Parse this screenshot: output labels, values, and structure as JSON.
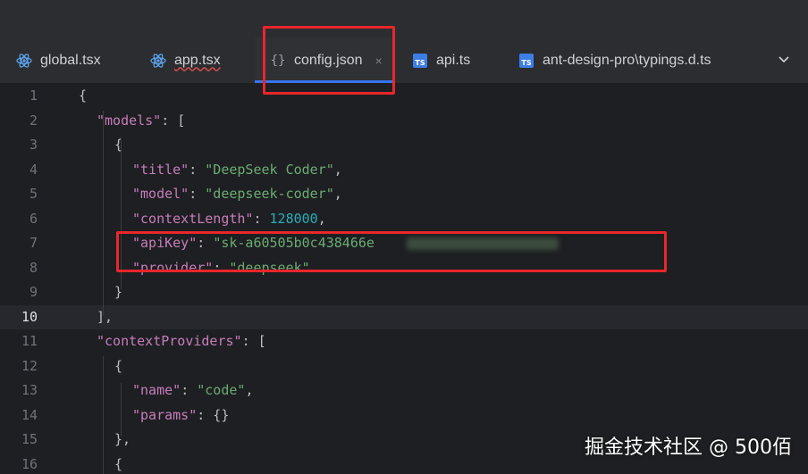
{
  "tabs": [
    {
      "label": "global.tsx",
      "icon": "react-icon",
      "active": false
    },
    {
      "label": "app.tsx",
      "icon": "react-icon",
      "active": false
    },
    {
      "label": "config.json",
      "icon": "json-braces-icon",
      "active": true,
      "close": "×"
    },
    {
      "label": "api.ts",
      "icon": "typescript-icon",
      "active": false,
      "badge": "TS"
    },
    {
      "label": "ant-design-pro\\typings.d.ts",
      "icon": "typescript-icon",
      "active": false,
      "badge": "TS"
    }
  ],
  "editor": {
    "current_line": 10,
    "lines": [
      {
        "num": "1",
        "tokens": [
          [
            "p",
            "{"
          ]
        ]
      },
      {
        "num": "2",
        "tokens": [
          [
            "k",
            "\"models\""
          ],
          [
            "p",
            ": ["
          ]
        ]
      },
      {
        "num": "3",
        "tokens": [
          [
            "p",
            "{"
          ]
        ]
      },
      {
        "num": "4",
        "tokens": [
          [
            "k",
            "\"title\""
          ],
          [
            "p",
            ": "
          ],
          [
            "s",
            "\"DeepSeek Coder\""
          ],
          [
            "p",
            ","
          ]
        ]
      },
      {
        "num": "5",
        "tokens": [
          [
            "k",
            "\"model\""
          ],
          [
            "p",
            ": "
          ],
          [
            "s",
            "\"deepseek-coder\""
          ],
          [
            "p",
            ","
          ]
        ]
      },
      {
        "num": "6",
        "tokens": [
          [
            "k",
            "\"contextLength\""
          ],
          [
            "p",
            ": "
          ],
          [
            "n",
            "128000"
          ],
          [
            "p",
            ","
          ]
        ]
      },
      {
        "num": "7",
        "tokens": [
          [
            "k",
            "\"apiKey\""
          ],
          [
            "p",
            ": "
          ],
          [
            "s",
            "\"sk-a60505b0c438466e"
          ]
        ]
      },
      {
        "num": "8",
        "tokens": [
          [
            "k",
            "\"provider\""
          ],
          [
            "p",
            ": "
          ],
          [
            "s",
            "\"deepseek\""
          ]
        ]
      },
      {
        "num": "9",
        "tokens": [
          [
            "p",
            "}"
          ]
        ]
      },
      {
        "num": "10",
        "tokens": [
          [
            "p",
            "],"
          ]
        ]
      },
      {
        "num": "11",
        "tokens": [
          [
            "k",
            "\"contextProviders\""
          ],
          [
            "p",
            ": ["
          ]
        ]
      },
      {
        "num": "12",
        "tokens": [
          [
            "p",
            "{"
          ]
        ]
      },
      {
        "num": "13",
        "tokens": [
          [
            "k",
            "\"name\""
          ],
          [
            "p",
            ": "
          ],
          [
            "s",
            "\"code\""
          ],
          [
            "p",
            ","
          ]
        ]
      },
      {
        "num": "14",
        "tokens": [
          [
            "k",
            "\"params\""
          ],
          [
            "p",
            ": {}"
          ]
        ]
      },
      {
        "num": "15",
        "tokens": [
          [
            "p",
            "},"
          ]
        ]
      },
      {
        "num": "16",
        "tokens": [
          [
            "p",
            "{"
          ]
        ]
      }
    ]
  },
  "watermark": "掘金技术社区 @ 500佰",
  "colors": {
    "accent": "#3574f0",
    "highlight_box": "#e8262b",
    "key": "#c77dbb",
    "string": "#6aab73",
    "number": "#2aacb8"
  }
}
